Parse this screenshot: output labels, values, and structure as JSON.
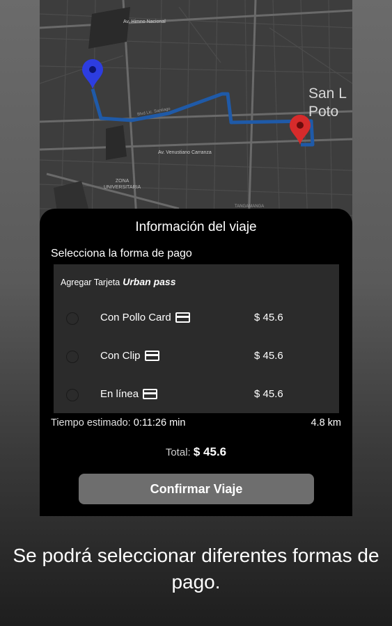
{
  "map": {
    "streets": [
      "Av. Himno Nacional",
      "Av. Venustiano Carranza",
      "Blvd Lic. Santiago",
      "Av. Venustiano Carranza"
    ],
    "district": [
      "ZONA",
      "UNIVERSITARIA"
    ],
    "city": "San L\nPoto",
    "bottom_label": "TANGAMANGA"
  },
  "sheet": {
    "title": "Información del viaje",
    "select_label": "Selecciona la forma de pago",
    "add_card_label": "Agregar Tarjeta",
    "brand": "Urban pass",
    "options": [
      {
        "label": "Con Pollo Card",
        "price": "$ 45.6"
      },
      {
        "label": "Con Clip",
        "price": "$ 45.6"
      },
      {
        "label": "En línea",
        "price": "$ 45.6"
      }
    ],
    "time_label": "Tiempo estimado:",
    "time_value": "0:11:26 min",
    "distance": "4.8 km",
    "total_label": "Total:",
    "total_value": "$ 45.6",
    "confirm_label": "Confirmar Viaje"
  },
  "caption": "Se podrá seleccionar diferentes formas de pago.",
  "colors": {
    "route": "#1f5aa8",
    "origin_pin": "#2d3de0",
    "destination_pin": "#d62b2b",
    "button": "#6e6e6e"
  }
}
